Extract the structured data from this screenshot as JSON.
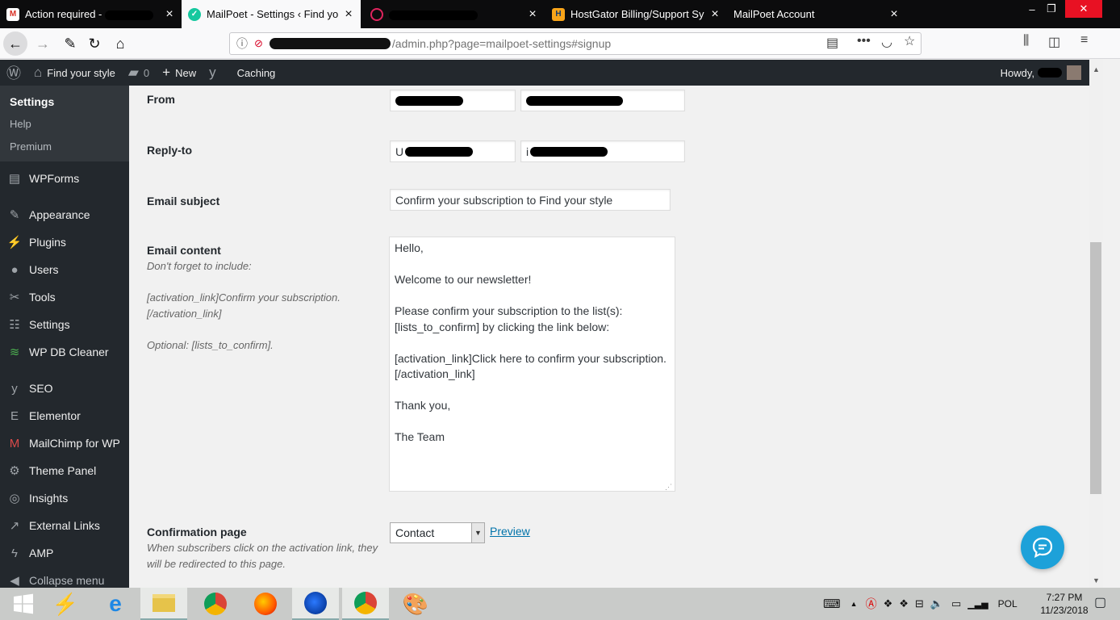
{
  "browser": {
    "tabs": [
      {
        "title": "Action required - ",
        "favicon": "gmail-icon",
        "active": false
      },
      {
        "title": "MailPoet - Settings ‹ Find your",
        "favicon": "mailpoet-icon",
        "active": true
      },
      {
        "title": "",
        "favicon": "target-icon",
        "active": false
      },
      {
        "title": "HostGator Billing/Support Syste",
        "favicon": "hostgator-icon",
        "active": false
      },
      {
        "title": "MailPoet Account",
        "favicon": "",
        "active": false
      }
    ],
    "window_controls": {
      "minimize": "–",
      "restore": "❐",
      "close": "✕"
    },
    "url_suffix": "/admin.php?page=mailpoet-settings#signup"
  },
  "admin_bar": {
    "site_name": "Find your style",
    "comments_count": "0",
    "new_label": "New",
    "caching_label": "Caching",
    "howdy": "Howdy,"
  },
  "sidebar": {
    "submenu": [
      {
        "label": "Settings",
        "current": true
      },
      {
        "label": "Help",
        "current": false
      },
      {
        "label": "Premium",
        "current": false
      }
    ],
    "items": [
      {
        "label": "WPForms",
        "icon": "wpforms-icon",
        "glyph": "▤"
      },
      {
        "label": "Appearance",
        "icon": "paintbrush-icon",
        "glyph": "✎"
      },
      {
        "label": "Plugins",
        "icon": "plugin-icon",
        "glyph": "⚡"
      },
      {
        "label": "Users",
        "icon": "users-icon",
        "glyph": "●"
      },
      {
        "label": "Tools",
        "icon": "wrench-icon",
        "glyph": "✂"
      },
      {
        "label": "Settings",
        "icon": "settings-sliders-icon",
        "glyph": "☷"
      },
      {
        "label": "WP DB Cleaner",
        "icon": "database-icon",
        "glyph": "≋"
      },
      {
        "label": "SEO",
        "icon": "yoast-icon",
        "glyph": "y"
      },
      {
        "label": "Elementor",
        "icon": "elementor-icon",
        "glyph": "E"
      },
      {
        "label": "MailChimp for WP",
        "icon": "mailchimp-icon",
        "glyph": "M"
      },
      {
        "label": "Theme Panel",
        "icon": "gear-icon",
        "glyph": "⚙"
      },
      {
        "label": "Insights",
        "icon": "insights-icon",
        "glyph": "◎"
      },
      {
        "label": "External Links",
        "icon": "external-link-icon",
        "glyph": "↗"
      },
      {
        "label": "AMP",
        "icon": "amp-icon",
        "glyph": "ϟ"
      },
      {
        "label": "Collapse menu",
        "icon": "collapse-icon",
        "glyph": "◀"
      }
    ]
  },
  "form": {
    "from_label": "From",
    "reply_to_label": "Reply-to",
    "reply_to_name_prefix": "U",
    "reply_to_email_prefix": "i",
    "email_subject_label": "Email subject",
    "email_subject_value": "Confirm your subscription to Find your style",
    "email_content_label": "Email content",
    "email_content_hint_1": "Don't forget to include:",
    "email_content_hint_2": "[activation_link]Confirm your subscription. [/activation_link]",
    "email_content_hint_3": "Optional: [lists_to_confirm].",
    "email_content_value": "Hello,\n\nWelcome to our newsletter!\n\nPlease confirm your subscription to the list(s):\n[lists_to_confirm] by clicking the link below:\n\n[activation_link]Click here to confirm your subscription.\n[/activation_link]\n\nThank you,\n\nThe Team",
    "confirmation_page_label": "Confirmation page",
    "confirmation_page_hint": "When subscribers click on the activation link, they will be redirected to this page.",
    "confirmation_page_value": "Contact",
    "preview_link": "Preview"
  },
  "taskbar": {
    "language": "POL",
    "time": "7:27 PM",
    "date": "11/23/2018"
  },
  "colors": {
    "wp_dark": "#23282d",
    "wp_submenu": "#32373c",
    "link_blue": "#0073aa",
    "chat_blue": "#1da1d9",
    "firefox_close_red": "#e81123"
  }
}
